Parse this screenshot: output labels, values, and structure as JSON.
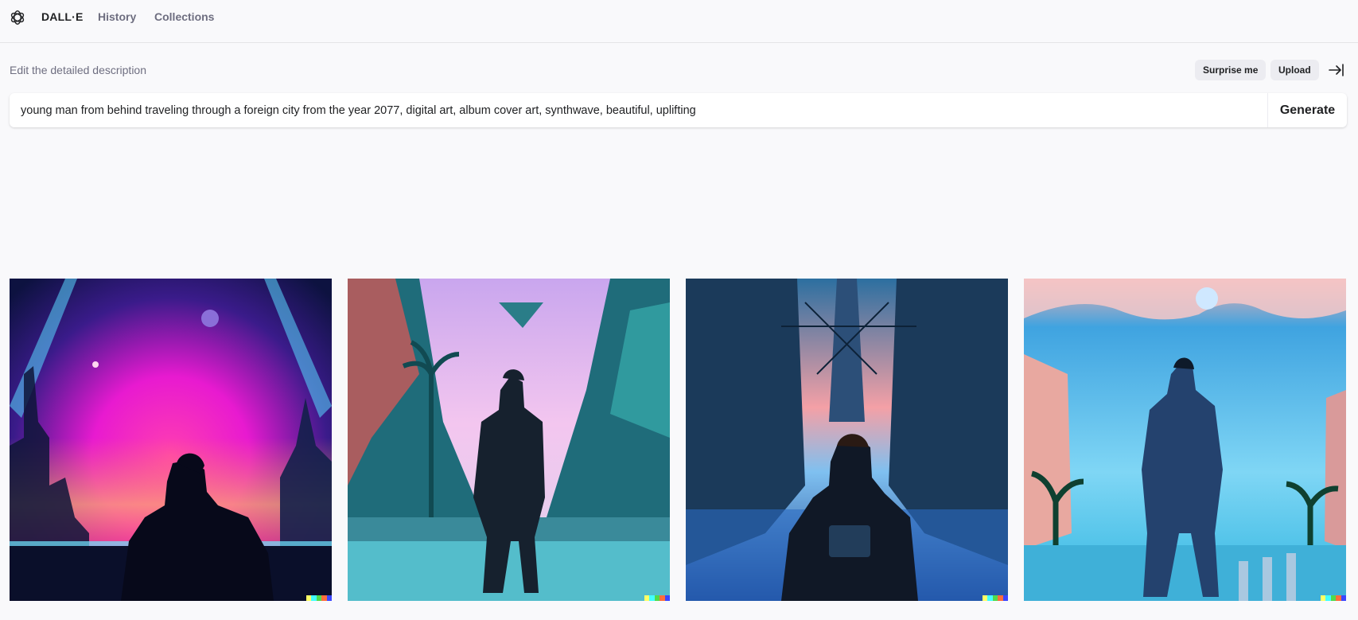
{
  "nav": {
    "brand": "DALL·E",
    "history": "History",
    "collections": "Collections"
  },
  "prompt": {
    "label": "Edit the detailed description",
    "surprise_label": "Surprise me",
    "upload_label": "Upload",
    "value": "young man from behind traveling through a foreign city from the year 2077, digital art, album cover art, synthwave, beautiful, uplifting",
    "generate_label": "Generate"
  },
  "icons": {
    "logo": "openai-logo-icon",
    "collapse": "collapse-panel-icon"
  },
  "watermark_colors": [
    "#ffff66",
    "#42ffff",
    "#51da4c",
    "#ff6e3c",
    "#3c46ff"
  ]
}
